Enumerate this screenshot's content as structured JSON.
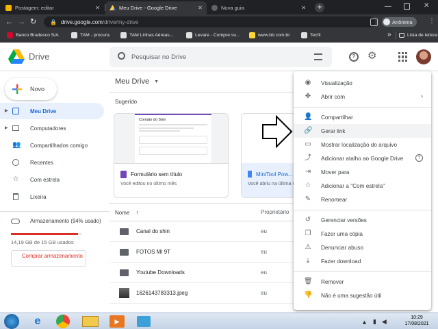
{
  "browser": {
    "tabs": [
      {
        "title": "Postagem: editar",
        "color": "#f4b400"
      },
      {
        "title": "Meu Drive - Google Drive",
        "color": "#1fa463"
      },
      {
        "title": "Nova guia",
        "color": "#9aa0a6"
      }
    ],
    "new_tab": "+",
    "url_domain": "drive.google.com",
    "url_path": "/drive/my-drive",
    "profile_label": "Anônima",
    "bookmarks": [
      {
        "label": "Banco Bradesco S/A",
        "color": "#cc092f"
      },
      {
        "label": "TAM - procura",
        "color": "#e0e0e0"
      },
      {
        "label": "TAM Linhas Aéreas...",
        "color": "#e0e0e0"
      },
      {
        "label": "Levare - Compre su...",
        "color": "#e0e0e0"
      },
      {
        "label": "www.bb.com.br",
        "color": "#fdd835"
      },
      {
        "label": "Tecfil",
        "color": "#e0e0e0"
      }
    ],
    "bookmarks_more": "»",
    "reading_list": "Lista de leitura"
  },
  "drive": {
    "logo_text": "Drive",
    "search_placeholder": "Pesquisar no Drive",
    "new_button": "Novo",
    "nav": [
      {
        "label": "Meu Drive",
        "icon": "my-drive-icon",
        "selected": true
      },
      {
        "label": "Computadores",
        "icon": "computer-icon"
      },
      {
        "label": "Compartilhados comigo",
        "icon": "shared-icon"
      },
      {
        "label": "Recentes",
        "icon": "clock-icon"
      },
      {
        "label": "Com estrela",
        "icon": "star-icon"
      },
      {
        "label": "Lixeira",
        "icon": "trash-icon"
      }
    ],
    "storage": {
      "label": "Armazenamento (94% usado)",
      "usage": "14,19 GB de 15 GB usados",
      "used_fraction": 0.94,
      "buy_button": "Comprar armazenamento",
      "bar_color": "#d93025"
    },
    "title": "Meu Drive",
    "suggested_label": "Sugerido",
    "cards": [
      {
        "name": "Formulário sem título",
        "sub": "Você editou no último mês",
        "preview_title": "Contato do Shin",
        "icon_color": "#7248b9"
      },
      {
        "name": "MiniTool Pow...",
        "sub": "Você abriu na última semana",
        "icon_color": "#4285f4"
      }
    ],
    "columns": {
      "name": "Nome",
      "owner": "Proprietário"
    },
    "files": [
      {
        "name": "Canal do shin",
        "owner": "eu",
        "type": "folder"
      },
      {
        "name": "FOTOS MI 9T",
        "owner": "eu",
        "type": "shared-folder"
      },
      {
        "name": "Youtube Downloads",
        "owner": "eu",
        "type": "folder"
      },
      {
        "name": "1626143783313.jpeg",
        "owner": "eu",
        "type": "image"
      }
    ]
  },
  "context_menu": {
    "items": [
      {
        "label": "Visualização",
        "icon": "eye-icon"
      },
      {
        "label": "Abrir com",
        "icon": "move-icon",
        "submenu": true
      },
      {
        "sep": true
      },
      {
        "label": "Compartilhar",
        "icon": "person-add-icon"
      },
      {
        "label": "Gerar link",
        "icon": "link-icon",
        "highlighted": true
      },
      {
        "label": "Mostrar localização do arquivo",
        "icon": "folder-icon"
      },
      {
        "label": "Adicionar atalho ao Google Drive",
        "icon": "shortcut-icon",
        "help": true
      },
      {
        "label": "Mover para",
        "icon": "move-to-icon"
      },
      {
        "label": "Adicionar a \"Com estrela\"",
        "icon": "star-icon"
      },
      {
        "label": "Renomear",
        "icon": "pencil-icon"
      },
      {
        "sep": true
      },
      {
        "label": "Gerenciar versões",
        "icon": "history-icon"
      },
      {
        "label": "Fazer uma cópia",
        "icon": "copy-icon"
      },
      {
        "label": "Denunciar abuso",
        "icon": "report-icon"
      },
      {
        "label": "Fazer download",
        "icon": "download-icon"
      },
      {
        "sep": true
      },
      {
        "label": "Remover",
        "icon": "trash-icon"
      },
      {
        "label": "Não é uma sugestão útil",
        "icon": "thumbs-down-icon"
      }
    ]
  },
  "taskbar": {
    "time": "10:29",
    "date": "17/08/2021"
  }
}
